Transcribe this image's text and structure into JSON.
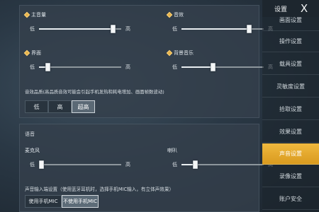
{
  "panel_audio": {
    "master": {
      "label": "主音量",
      "low": "低",
      "high": "高",
      "level": 0.9
    },
    "sfx": {
      "label": "音效",
      "low": "低",
      "high": "高",
      "level": 0.82
    },
    "ui": {
      "label": "界面",
      "low": "低",
      "high": "高",
      "level": 0.1
    },
    "bgm": {
      "label": "背景音乐",
      "low": "低",
      "high": "高",
      "level": 0.38
    },
    "quality_label": "音效品质(高品质音效可能会引起手机发热和耗电增加、画面帧数波动)",
    "quality_options": [
      "低",
      "高",
      "超高"
    ],
    "quality_selected": "超高"
  },
  "panel_voice": {
    "title": "语音",
    "mic": {
      "label": "麦克风",
      "low": "低",
      "high": "高",
      "level": 0.03
    },
    "speaker": {
      "label": "喇叭",
      "low": "低",
      "high": "高",
      "level": 0.16
    },
    "input_label": "声音输入端设置（使用蓝牙耳机时，选择手机MIC输入，有立体声效果）",
    "input_options": [
      "使用手机MIC",
      "不使用手机MIC"
    ],
    "input_selected": "不使用手机MIC"
  },
  "side": {
    "title": "设置",
    "close": "X",
    "items": [
      "画面设置",
      "操作设置",
      "载具设置",
      "灵敏度设置",
      "拾取设置",
      "效果设置",
      "声音设置",
      "录像设置",
      "账户安全"
    ],
    "active": "声音设置"
  },
  "colors": {
    "accent": "#e8a82e",
    "panel": "#34404c"
  }
}
